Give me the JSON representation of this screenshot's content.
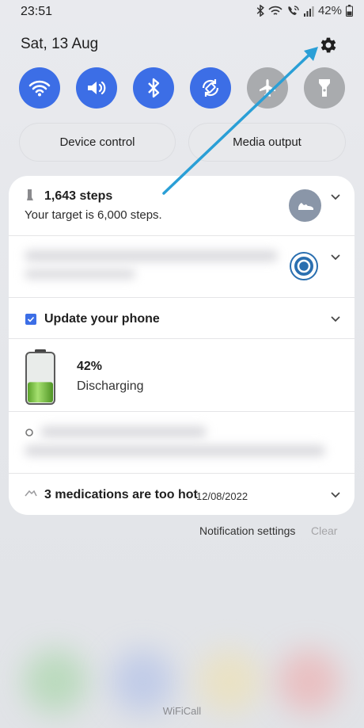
{
  "status_bar": {
    "time": "23:51",
    "battery_percent": "42%",
    "icons": [
      "bluetooth-icon",
      "wifi-calling-icon",
      "call-wifi-icon",
      "signal-icon",
      "battery-icon"
    ]
  },
  "header": {
    "date": "Sat, 13 Aug",
    "settings_icon": "gear-icon"
  },
  "quick_toggles": [
    {
      "name": "wifi",
      "icon": "wifi-icon",
      "state": "on"
    },
    {
      "name": "sound",
      "icon": "volume-icon",
      "state": "on"
    },
    {
      "name": "bluetooth",
      "icon": "bluetooth-icon",
      "state": "on"
    },
    {
      "name": "auto-rotate",
      "icon": "rotate-icon",
      "state": "on"
    },
    {
      "name": "airplane",
      "icon": "airplane-icon",
      "state": "off"
    },
    {
      "name": "flashlight",
      "icon": "flashlight-icon",
      "state": "off"
    }
  ],
  "buttons": {
    "device_control": "Device control",
    "media_output": "Media output"
  },
  "notifications": {
    "steps": {
      "title": "1,643 steps",
      "subtitle": "Your target is 6,000 steps.",
      "icon": "shoe-icon"
    },
    "update": {
      "title": "Update your phone"
    },
    "battery": {
      "percent": "42%",
      "status": "Discharging",
      "level": 0.42
    },
    "meds": {
      "title": "3 medications are too hot",
      "date": "12/08/2022"
    }
  },
  "footer": {
    "notification_settings": "Notification settings",
    "clear": "Clear",
    "carrier": "WiFiCall"
  },
  "colors": {
    "accent": "#3c6ee6",
    "toggle_off": "#a9abae",
    "arrow": "#2a9fd6",
    "battery_green": "#7cc43a"
  }
}
